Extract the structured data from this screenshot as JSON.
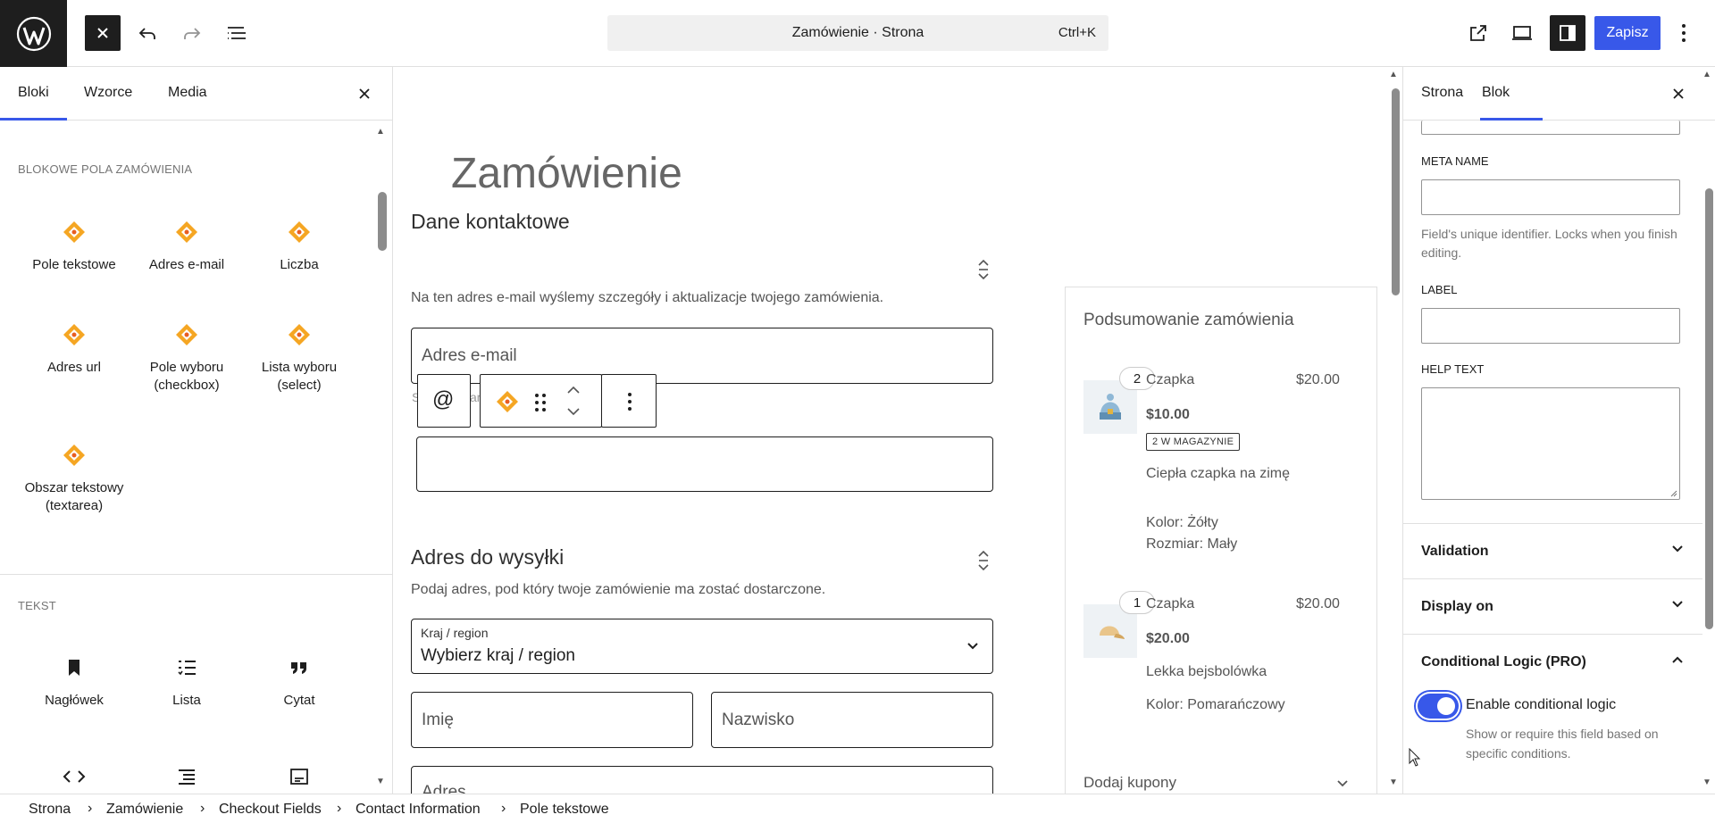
{
  "header": {
    "command_center": "Zamówienie · Strona",
    "shortcut": "Ctrl+K",
    "save_label": "Zapisz"
  },
  "inserter": {
    "tabs": [
      "Bloki",
      "Wzorce",
      "Media"
    ],
    "category1": "BLOKOWE POLA ZAMÓWIENIA",
    "blocks1": [
      "Pole tekstowe",
      "Adres e-mail",
      "Liczba",
      "Adres url",
      "Pole wyboru (checkbox)",
      "Lista wyboru (select)",
      "Obszar tekstowy (textarea)"
    ],
    "category2": "TEKST",
    "blocks2": [
      "Nagłówek",
      "Lista",
      "Cytat"
    ]
  },
  "canvas": {
    "page_title": "Zamówienie",
    "contact": {
      "title": "Dane kontaktowe",
      "subtitle": "Na ten adres e-mail wyślemy szczegóły i aktualizacje twojego zamówienia.",
      "email_placeholder": "Adres e-mail",
      "hidden_text_start": "S",
      "hidden_text_end": "ar"
    },
    "shipping": {
      "title": "Adres do wysyłki",
      "subtitle": "Podaj adres, pod który twoje zamówienie ma zostać dostarczone.",
      "country_label": "Kraj / region",
      "country_value": "Wybierz kraj / region",
      "first_name": "Imię",
      "last_name": "Nazwisko",
      "address": "Adres"
    },
    "summary": {
      "title": "Podsumowanie zamówienia",
      "items": [
        {
          "qty": "2",
          "name": "Czapka",
          "total": "$20.00",
          "price": "$10.00",
          "stock": "2 W MAGAZYNIE",
          "desc": "Ciepła czapka na zimę",
          "attr1": "Kolor: Żółty",
          "attr2": "Rozmiar: Mały"
        },
        {
          "qty": "1",
          "name": "Czapka",
          "total": "$20.00",
          "price": "$20.00",
          "desc": "Lekka bejsbolówka",
          "attr1": "Kolor: Pomarańczowy"
        }
      ],
      "coupon": "Dodaj kupony"
    },
    "toolbar": {
      "at_symbol": "@"
    }
  },
  "settings": {
    "tabs": [
      "Strona",
      "Blok"
    ],
    "meta_name_label": "META NAME",
    "meta_name_help": "Field's unique identifier. Locks when you finish editing.",
    "label_label": "LABEL",
    "help_text_label": "HELP TEXT",
    "panels": [
      "Validation",
      "Display on",
      "Conditional Logic (PRO)"
    ],
    "toggle_label": "Enable conditional logic",
    "toggle_help": "Show or require this field based on specific conditions."
  },
  "breadcrumb": [
    "Strona",
    "Zamówienie",
    "Checkout Fields",
    "Contact Information",
    "Pole tekstowe"
  ],
  "colors": {
    "accent": "#3858e9",
    "brand_orange": "#f5a623",
    "dark": "#1e1e1e"
  }
}
